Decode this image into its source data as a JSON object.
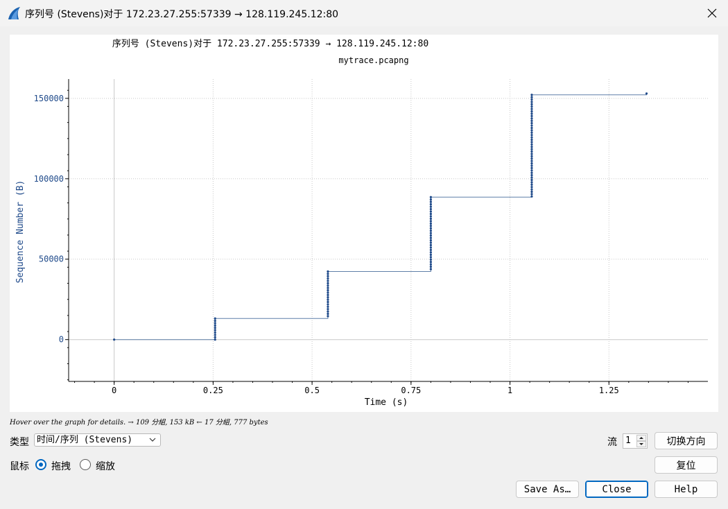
{
  "window": {
    "title": "序列号 (Stevens)对于 172.23.27.255:57339 → 128.119.245.12:80",
    "close_icon": "close-icon"
  },
  "chart_data": {
    "type": "scatter",
    "title": "序列号 (Stevens)对于 172.23.27.255:57339 → 128.119.245.12:80",
    "subtitle": "mytrace.pcapng",
    "xlabel": "Time (s)",
    "ylabel": "Sequence Number (B)",
    "xlim": [
      -0.115,
      1.5
    ],
    "ylim": [
      -26000,
      162000
    ],
    "x_ticks": [
      0,
      0.25,
      0.5,
      0.75,
      1,
      1.25
    ],
    "x_tick_labels": [
      "0",
      "0.25",
      "0.5",
      "0.75",
      "1",
      "1.25"
    ],
    "y_ticks": [
      0,
      50000,
      100000,
      150000
    ],
    "y_tick_labels": [
      "0",
      "50000",
      "100000",
      "150000"
    ],
    "grid": true,
    "series": [
      {
        "color": "#1f4a8a",
        "bursts": [
          {
            "x": 0,
            "y_start": 0,
            "y_end": 0,
            "count": 1
          },
          {
            "x": 0.255,
            "y_start": 0,
            "y_end": 13140,
            "count": 10
          },
          {
            "x": 0.54,
            "y_start": 14600,
            "y_end": 42340,
            "count": 20
          },
          {
            "x": 0.8,
            "y_start": 43800,
            "y_end": 88600,
            "count": 31
          },
          {
            "x": 1.055,
            "y_start": 89000,
            "y_end": 152200,
            "count": 44
          },
          {
            "x": 1.345,
            "y_start": 153000,
            "y_end": 153000,
            "count": 1
          }
        ]
      }
    ]
  },
  "status_hint": "Hover over the graph for details. → 109 分組, 153 kB ← 17 分組, 777 bytes",
  "controls": {
    "type_label": "类型",
    "type_value": "时间/序列 (Stevens)",
    "stream_label": "流",
    "stream_value": "1",
    "switch_direction": "切换方向",
    "mouse_label": "鼠标",
    "drag_label": "拖拽",
    "zoom_label": "缩放",
    "reset": "复位",
    "save_as": "Save As…",
    "close": "Close",
    "help": "Help"
  }
}
